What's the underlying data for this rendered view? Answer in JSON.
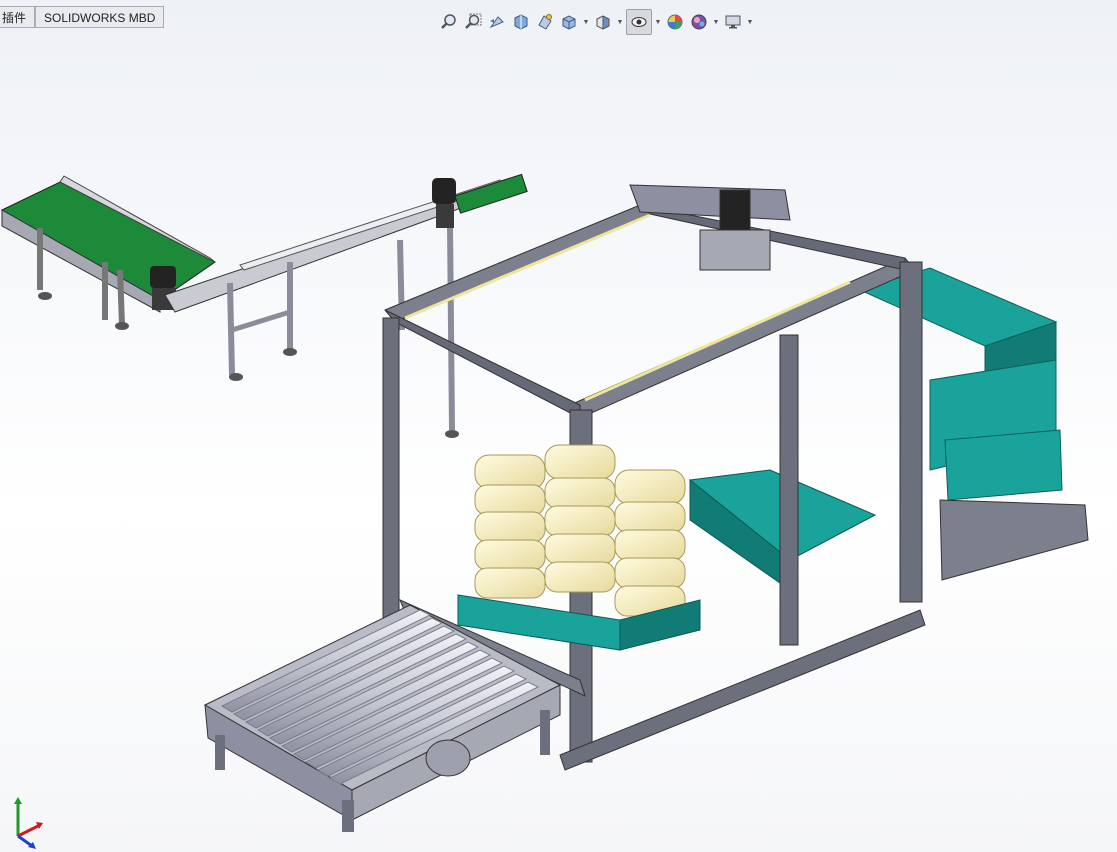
{
  "tabs": [
    {
      "label": "插件"
    },
    {
      "label": "SOLIDWORKS MBD"
    }
  ],
  "heads_up_toolbar": {
    "buttons": [
      {
        "icon": "zoom-to-fit-icon"
      },
      {
        "icon": "zoom-to-area-icon"
      },
      {
        "icon": "previous-view-icon"
      },
      {
        "icon": "section-view-icon"
      },
      {
        "icon": "dynamic-annotation-views-icon"
      },
      {
        "icon": "view-orientation-icon"
      },
      {
        "icon": "display-style-icon"
      },
      {
        "icon": "hide-show-items-icon"
      },
      {
        "icon": "edit-appearance-icon"
      },
      {
        "icon": "apply-scene-icon"
      },
      {
        "icon": "view-settings-icon"
      }
    ]
  },
  "colors": {
    "frame": "#7c7f8c",
    "frame_dark": "#4a4d59",
    "conveyor_belt": "#1d8a3a",
    "pallet": "#1aa39a",
    "bags": "#f3ecc0",
    "roller": "#c9cbd6"
  },
  "triad": {
    "x_axis_color": "#d11b1b",
    "y_axis_color": "#1f9a2a",
    "z_axis_color": "#1f3fd1"
  }
}
